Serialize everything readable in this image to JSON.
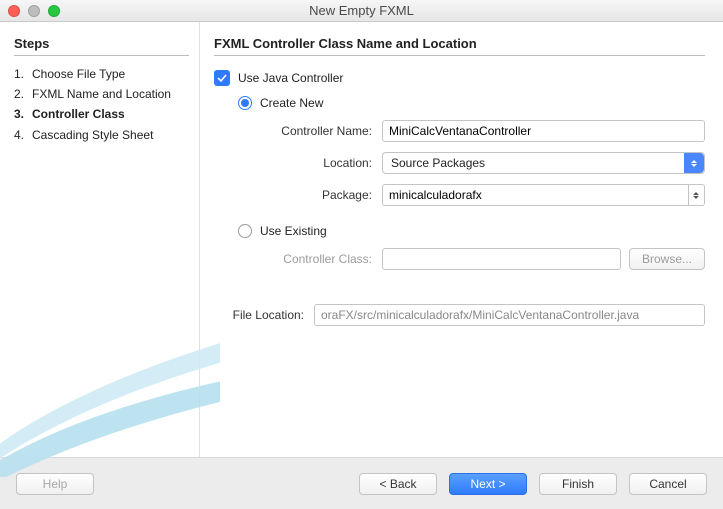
{
  "window": {
    "title": "New Empty FXML"
  },
  "sidebar": {
    "heading": "Steps",
    "items": [
      {
        "num": "1.",
        "label": "Choose File Type"
      },
      {
        "num": "2.",
        "label": "FXML Name and Location"
      },
      {
        "num": "3.",
        "label": "Controller Class"
      },
      {
        "num": "4.",
        "label": "Cascading Style Sheet"
      }
    ],
    "activeIndex": 2
  },
  "main": {
    "heading": "FXML Controller Class Name and Location",
    "useJavaController": {
      "label": "Use Java Controller",
      "checked": true
    },
    "createNew": {
      "label": "Create New",
      "selected": true,
      "controllerNameLabel": "Controller Name:",
      "controllerName": "MiniCalcVentanaController",
      "locationLabel": "Location:",
      "location": "Source Packages",
      "packageLabel": "Package:",
      "package": "minicalculadorafx"
    },
    "useExisting": {
      "label": "Use Existing",
      "selected": false,
      "controllerClassLabel": "Controller Class:",
      "controllerClass": "",
      "browse": "Browse..."
    },
    "fileLocation": {
      "label": "File Location:",
      "value": "oraFX/src/minicalculadorafx/MiniCalcVentanaController.java"
    }
  },
  "footer": {
    "help": "Help",
    "back": "< Back",
    "next": "Next >",
    "finish": "Finish",
    "cancel": "Cancel"
  }
}
